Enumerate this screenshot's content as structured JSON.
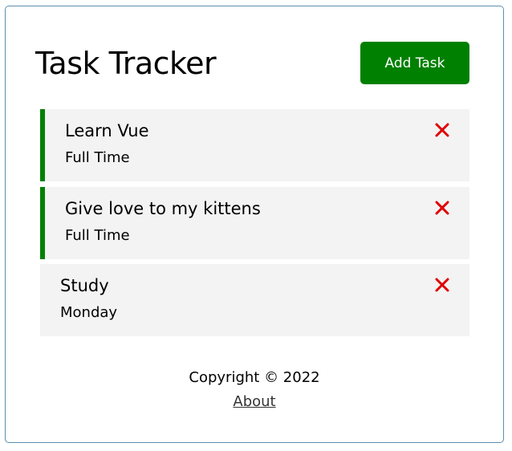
{
  "header": {
    "title": "Task Tracker",
    "add_button_label": "Add Task"
  },
  "tasks": [
    {
      "name": "Learn Vue",
      "day": "Full Time",
      "reminder": true
    },
    {
      "name": "Give love to my kittens",
      "day": "Full Time",
      "reminder": true
    },
    {
      "name": "Study",
      "day": "Monday",
      "reminder": false
    }
  ],
  "footer": {
    "copyright": "Copyright © 2022",
    "about_link": "About"
  },
  "colors": {
    "accent": "#008000",
    "delete": "#e00000",
    "task_bg": "#f3f3f3",
    "border": "#5e8fb0"
  },
  "icons": {
    "delete": "close-icon"
  }
}
